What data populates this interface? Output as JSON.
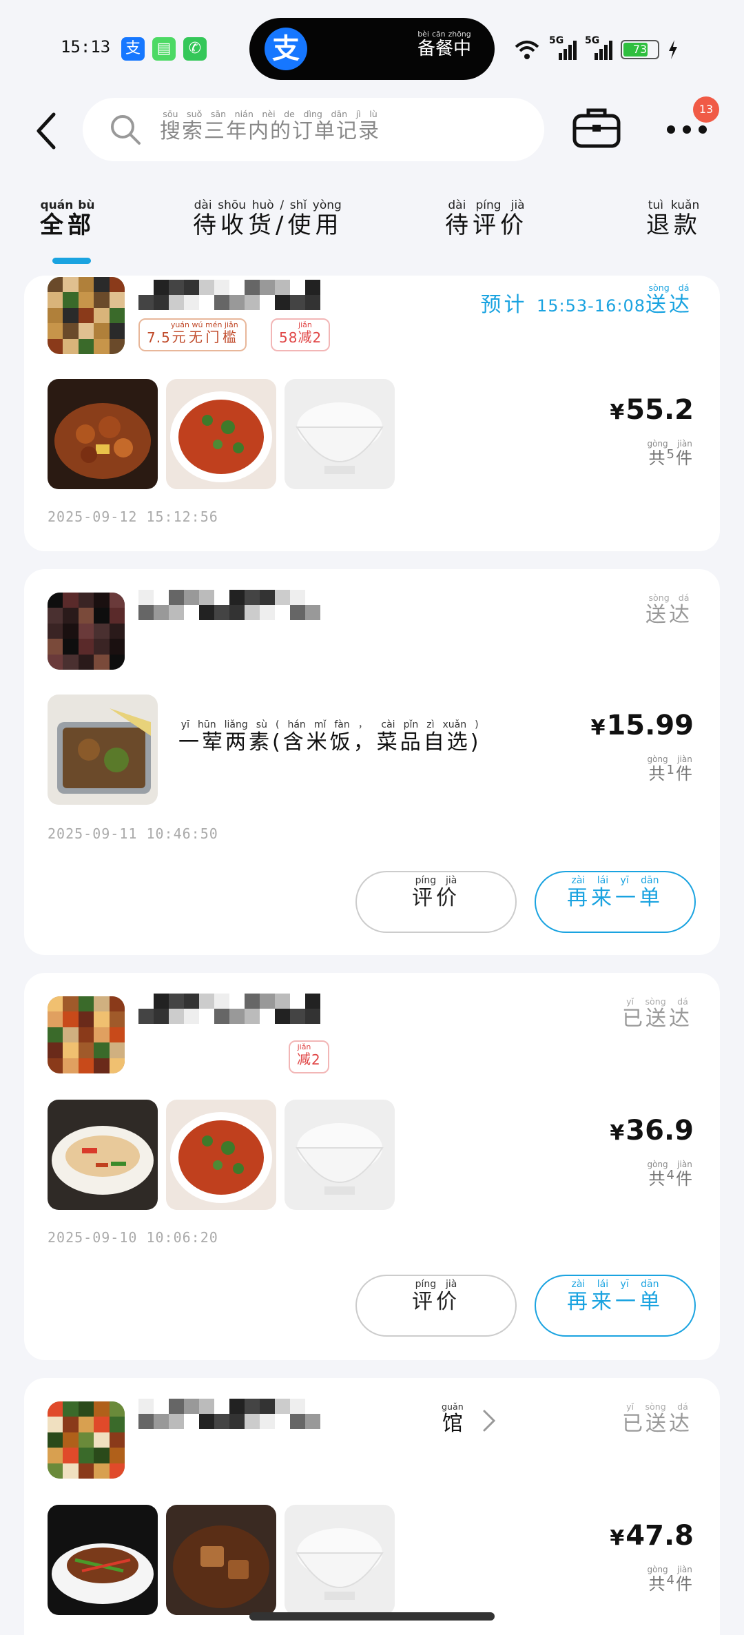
{
  "status_bar": {
    "time": "15:13",
    "app_icons": [
      {
        "name": "alipay-app-icon",
        "glyph": "支",
        "color": "#1677ff"
      },
      {
        "name": "messages-app-icon",
        "glyph": "▤",
        "color": "#4cd964"
      },
      {
        "name": "phone-app-icon",
        "glyph": "✆",
        "color": "#34c759"
      }
    ],
    "island": {
      "logo": "支",
      "text": "备餐中",
      "ruby": [
        "bèi",
        "cān",
        "zhōng"
      ]
    },
    "network_1": "5G",
    "network_2": "5G",
    "battery": "73",
    "battery_level": 0.73
  },
  "header": {
    "search_placeholder": "搜索三年内的订单记录",
    "search_ruby": [
      "sōu",
      "suǒ",
      "sān",
      "nián",
      "nèi",
      "de",
      "dìng",
      "dān",
      "jì",
      "lù"
    ],
    "notification_count": "13"
  },
  "tabs": [
    {
      "label": "全部",
      "ruby": [
        "quán",
        "bù"
      ],
      "active": true
    },
    {
      "label": "待收货/使用",
      "ruby": [
        "dài",
        "shōu",
        "huò",
        "/",
        "shǐ",
        "yòng"
      ],
      "active": false
    },
    {
      "label": "待评价",
      "ruby": [
        "dài",
        "píng",
        "jià"
      ],
      "active": false
    },
    {
      "label": "退款",
      "ruby": [
        "tuì",
        "kuǎn"
      ],
      "active": false
    }
  ],
  "orders": [
    {
      "status_prefix": "预计",
      "status_time": "15:53-16:08",
      "status": "送达",
      "status_ruby": [
        "sòng",
        "dá"
      ],
      "tags": [
        {
          "pre": "7.5",
          "text": "元无门槛",
          "ruby": [
            "yuán",
            "wú",
            "mén",
            "jiǎn"
          ]
        },
        {
          "pre": "58",
          "text": "减",
          "post": "2",
          "ruby": [
            "jiǎn"
          ]
        }
      ],
      "price": "55.2",
      "count": "5",
      "timestamp": "2025-09-12 15:12:56"
    },
    {
      "status": "送达",
      "status_ruby": [
        "sòng",
        "dá"
      ],
      "item_title": "一荤两素(含米饭，菜品自选)",
      "item_ruby": [
        "yī",
        "hūn",
        "liǎng",
        "sù",
        "(",
        "hán",
        "mǐ",
        "fàn",
        "，",
        "cài",
        "pǐn",
        "zì",
        "xuǎn",
        ")"
      ],
      "price": "15.99",
      "count": "1",
      "timestamp": "2025-09-11 10:46:50",
      "btn_review": "评价",
      "btn_reorder": "再来一单"
    },
    {
      "status": "已送达",
      "status_ruby": [
        "yǐ",
        "sòng",
        "dá"
      ],
      "tags": [
        {
          "text": "减",
          "post": "2",
          "ruby": [
            "jiǎn"
          ]
        }
      ],
      "price": "36.9",
      "count": "4",
      "timestamp": "2025-09-10 10:06:20",
      "btn_review": "评价",
      "btn_reorder": "再来一单"
    },
    {
      "shop_suffix": "馆",
      "shop_suffix_ruby": "guǎn",
      "status": "已送达",
      "status_ruby": [
        "yǐ",
        "sòng",
        "dá"
      ],
      "price": "47.8",
      "count": "4"
    }
  ],
  "common": {
    "currency": "¥",
    "count_prefix": "共",
    "count_prefix_ruby": "gòng",
    "count_suffix": "件",
    "count_suffix_ruby": "jiàn",
    "review_ruby": [
      "píng",
      "jià"
    ],
    "reorder_ruby": [
      "zài",
      "lái",
      "yī",
      "dān"
    ]
  },
  "colors": {
    "accent": "#1aa3e0",
    "badge": "#f05a46",
    "tag_text": "#c04a2a",
    "background": "#f4f5f9"
  }
}
